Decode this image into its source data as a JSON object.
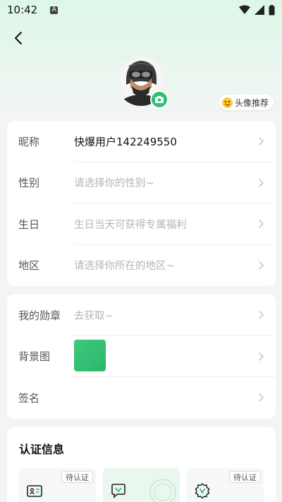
{
  "status_bar": {
    "time": "10:42",
    "app_icon": "A"
  },
  "avatar": {
    "recommend_label": "头像推荐"
  },
  "profile": {
    "nickname": {
      "label": "昵称",
      "value": "快爆用户142249550"
    },
    "gender": {
      "label": "性别",
      "placeholder": "请选择你的性别~"
    },
    "birthday": {
      "label": "生日",
      "placeholder": "生日当天可获得专属福利"
    },
    "region": {
      "label": "地区",
      "placeholder": "请选择你所在的地区~"
    }
  },
  "extras": {
    "medal": {
      "label": "我的勋章",
      "placeholder": "去获取~"
    },
    "background": {
      "label": "背景图"
    },
    "signature": {
      "label": "签名"
    }
  },
  "certification": {
    "title": "认证信息",
    "items": [
      {
        "badge": "待认证",
        "icon": "id-card-icon"
      },
      {
        "badge": "",
        "icon": "verified-chat-icon"
      },
      {
        "badge": "待认证",
        "icon": "verified-badge-icon"
      }
    ]
  },
  "colors": {
    "accent": "#2fbf71"
  }
}
